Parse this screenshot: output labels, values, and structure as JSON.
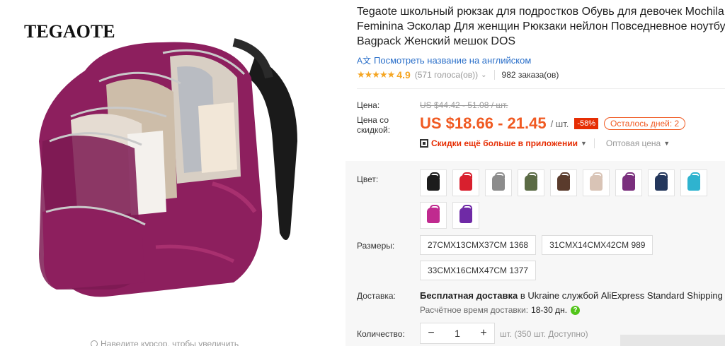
{
  "gallery": {
    "brand": "TEGAOTE",
    "zoom_hint": "Наведите курсор, чтобы увеличить"
  },
  "product": {
    "title": "Tegaote школьный рюкзак для подростков Обувь для девочек Mochila Feminina Эсколар Для женщин Рюкзаки нейлон Повседневное ноутбук Bagpack Женский мешок DOS",
    "translate_link": "Посмотреть название на английском",
    "rating": "4.9",
    "votes": "(571 голоса(ов))",
    "orders": "982 заказа(ов)"
  },
  "pricing": {
    "price_label": "Цена:",
    "old_price": "US $44.42 - 51.08 / шт.",
    "discount_label": "Цена со скидкой:",
    "price": "US $18.66 - 21.45",
    "unit": "/ шт.",
    "discount_badge": "-58%",
    "days_left": "Осталось дней: 2",
    "app_promo": "Скидки ещё больше в приложении",
    "wholesale": "Оптовая цена"
  },
  "options": {
    "color_label": "Цвет:",
    "colors": [
      "#1c1c1c",
      "#d8202e",
      "#8c8c8c",
      "#5b6b45",
      "#5a3b2c",
      "#d9c4b6",
      "#7a2f7d",
      "#24375c",
      "#2fb3cf",
      "#c02a8f",
      "#6f2aa6"
    ],
    "size_label": "Размеры:",
    "sizes": [
      "27CMX13CMX37CM 1368",
      "31CMX14CMX42CM 989",
      "33CMX16CMX47CM 1377"
    ]
  },
  "shipping": {
    "label": "Доставка:",
    "free_text": "Бесплатная доставка",
    "details": "в Ukraine службой AliExpress Standard Shipping",
    "est_label": "Расчётное время доставки:",
    "est_days": "18-30 дн."
  },
  "quantity": {
    "label": "Количество:",
    "value": "1",
    "available": "шт. (350 шт. Доступно)"
  }
}
